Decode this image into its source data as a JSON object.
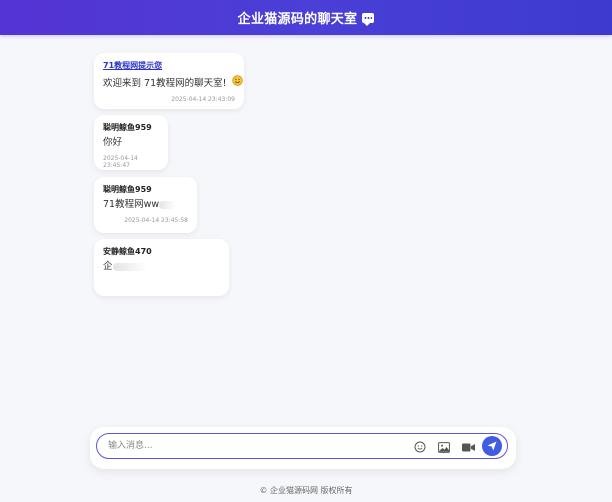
{
  "header": {
    "title": "企业猫源码的聊天室",
    "icon": "chat-bubble-icon"
  },
  "messages": [
    {
      "sender": "71教程网提示您",
      "text": "欢迎来到 71教程网的聊天室!",
      "time": "2025-04-14 23:43:09",
      "emoji": "smiling-face-icon"
    },
    {
      "sender": "聪明鲸鱼959",
      "text": "你好",
      "time": "2025-04-14 23:45:47"
    },
    {
      "sender": "聪明鲸鱼959",
      "text": "71教程网ww",
      "time": "2025-04-14 23:45:58"
    },
    {
      "sender": "安静鲸鱼470",
      "text": "企"
    }
  ],
  "composer": {
    "placeholder": "输入消息...",
    "icons": [
      "emoji-icon",
      "image-icon",
      "video-icon",
      "send-icon"
    ],
    "accent": "#3f5de0"
  },
  "footer": {
    "text": "© 企业猫源码网 版权所有"
  },
  "colors": {
    "header_start": "#5533d4",
    "header_end": "#3d3ad0",
    "background": "#f6f7fb"
  }
}
